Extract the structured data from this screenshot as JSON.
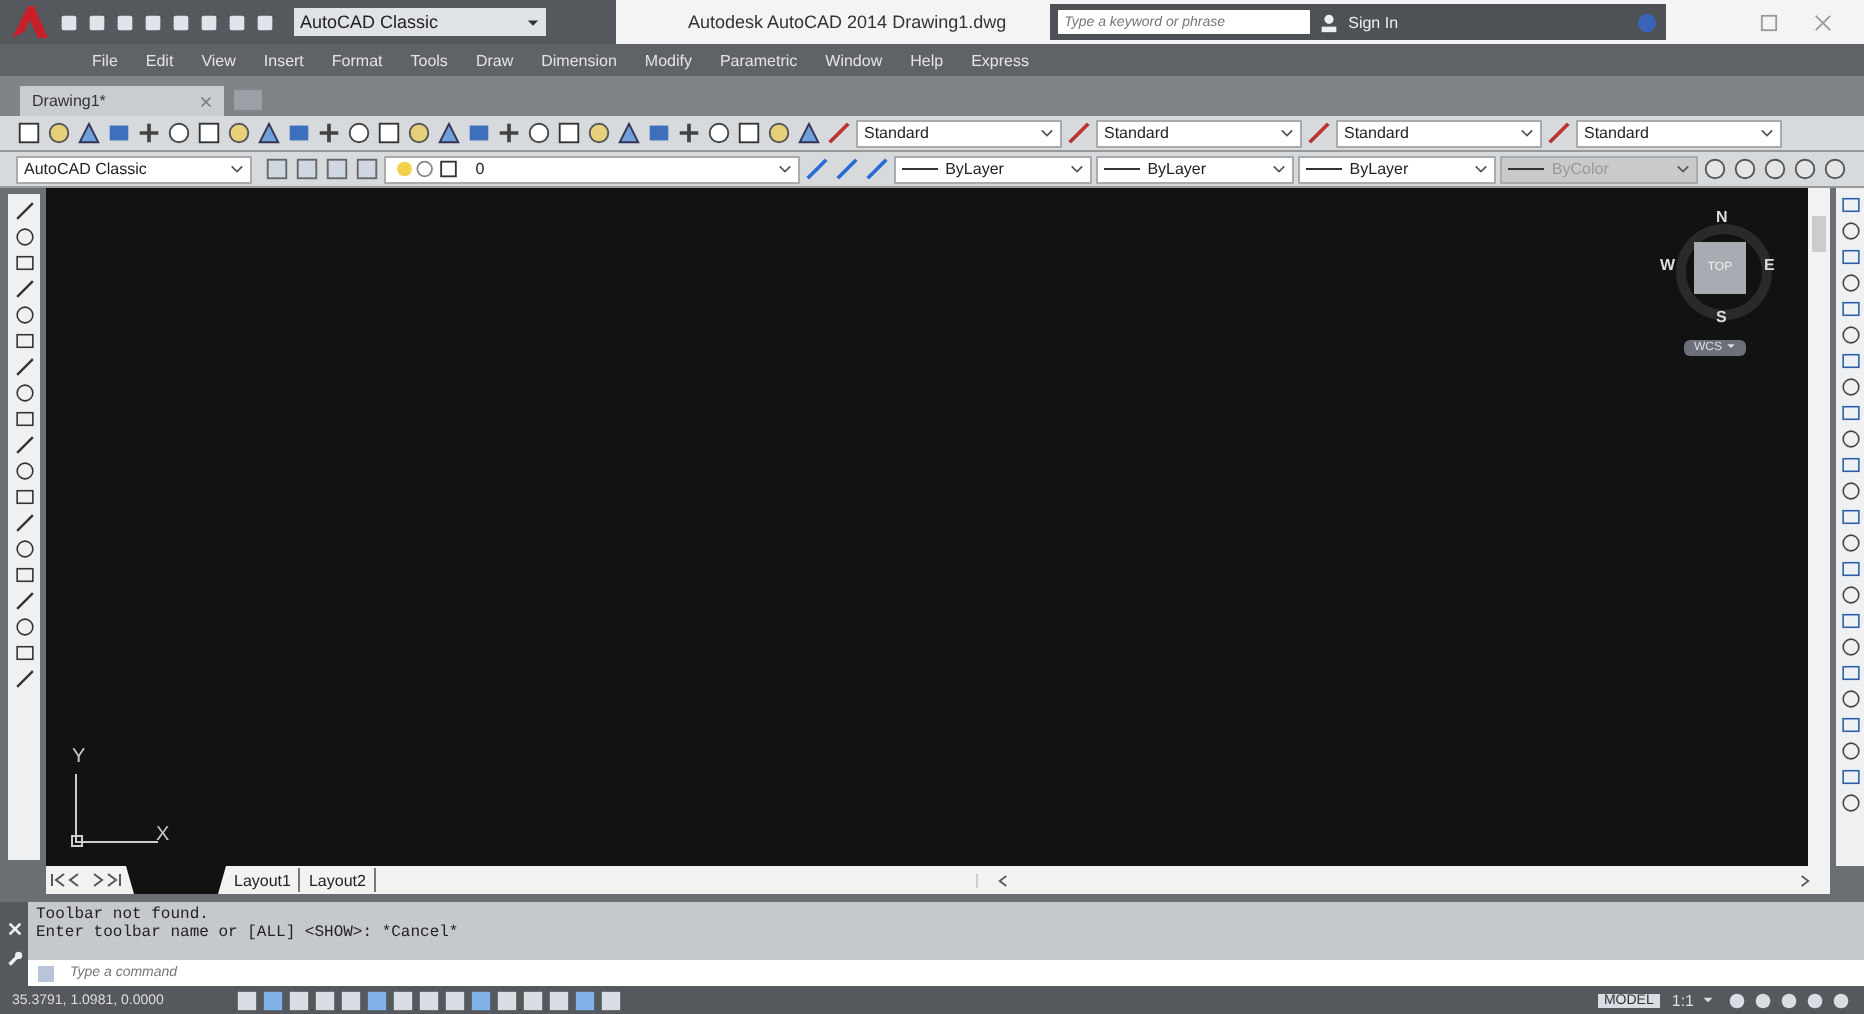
{
  "window": {
    "title": "Autodesk AutoCAD 2014   Drawing1.dwg",
    "workspace": "AutoCAD Classic",
    "search": {
      "placeholder": "Type a keyword or phrase"
    },
    "sign_in": "Sign In"
  },
  "menu": [
    "File",
    "Edit",
    "View",
    "Insert",
    "Format",
    "Tools",
    "Draw",
    "Dimension",
    "Modify",
    "Parametric",
    "Window",
    "Help",
    "Express"
  ],
  "doc_tabs": [
    {
      "label": "Drawing1*",
      "selected": true
    }
  ],
  "styles": [
    "Standard",
    "Standard",
    "Standard",
    "Standard"
  ],
  "workspace_box": "AutoCAD Classic",
  "layer": "0",
  "properties": [
    {
      "label": "ByLayer",
      "disabled": false
    },
    {
      "label": "ByLayer",
      "disabled": false
    },
    {
      "label": "ByLayer",
      "disabled": false
    },
    {
      "label": "ByColor",
      "disabled": true
    }
  ],
  "viewcube": {
    "north": "N",
    "south": "S",
    "east": "E",
    "west": "W",
    "face": "TOP",
    "ucs": "WCS"
  },
  "ucs_axes": {
    "x": "X",
    "y": "Y"
  },
  "layout_tabs": [
    {
      "label": "Layout1",
      "selected": false
    },
    {
      "label": "Layout2",
      "selected": false
    }
  ],
  "command_history": [
    "Toolbar not found.",
    "Enter toolbar name or [ALL] <SHOW>: *Cancel*"
  ],
  "command_line": {
    "placeholder": "Type a command"
  },
  "status_bar": {
    "coordinates": "35.3791, 1.0981, 0.0000",
    "space": "MODEL",
    "scale": "1:1"
  }
}
